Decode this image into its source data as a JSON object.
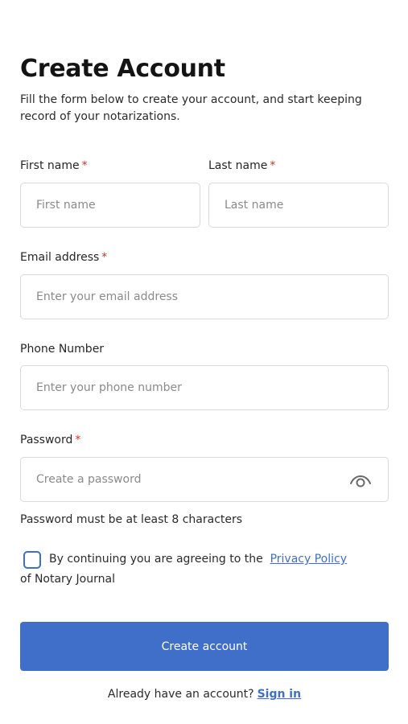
{
  "header": {
    "title": "Create Account",
    "subtitle": "Fill the form below to create your account, and start keeping record of your notarizations."
  },
  "form": {
    "required_marker": "*",
    "first_name": {
      "label": "First name",
      "placeholder": "First name",
      "value": ""
    },
    "last_name": {
      "label": "Last name",
      "placeholder": "Last name",
      "value": ""
    },
    "email": {
      "label": "Email address",
      "placeholder": "Enter your email address",
      "value": ""
    },
    "phone": {
      "label": "Phone Number",
      "placeholder": "Enter your phone number",
      "value": ""
    },
    "password": {
      "label": "Password",
      "placeholder": "Create a password",
      "value": "",
      "toggle_icon": "eye-icon",
      "hint": "Password must be at least 8 characters"
    },
    "consent": {
      "checked": false,
      "text_before": "By continuing you are agreeing to the",
      "link_text": "Privacy Policy",
      "text_after": "of Notary Journal"
    },
    "submit_label": "Create account"
  },
  "footer": {
    "prompt": "Already have an account?",
    "signin_label": "Sign in"
  },
  "colors": {
    "accent": "#3f6fc8",
    "required": "#c0392b",
    "border": "#d7d9dd"
  }
}
